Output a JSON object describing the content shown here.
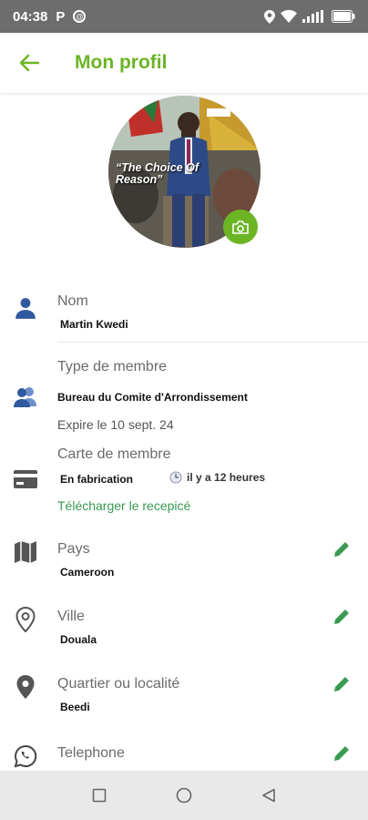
{
  "status_bar": {
    "time": "04:38",
    "p_icon": "P",
    "notif_icon": "@"
  },
  "header": {
    "title": "Mon profil",
    "back_icon": "arrow-left-icon",
    "accent_color": "#6bb524"
  },
  "avatar": {
    "banner_text": "“The Choice Of Reason”",
    "camera_icon": "camera-icon"
  },
  "fields": {
    "name": {
      "label": "Nom",
      "value": "Martin Kwedi",
      "icon": "person-icon"
    },
    "member_type": {
      "label": "Type de membre",
      "value": "Bureau du Comite d'Arrondissement",
      "expiry": "Expire le 10 sept. 24",
      "icon": "group-icon"
    },
    "member_card": {
      "label": "Carte de membre",
      "status": "En fabrication",
      "time_ago": "il y a 12 heures",
      "download_link": "Télécharger le recepicé",
      "icon": "card-icon"
    },
    "country": {
      "label": "Pays",
      "value": "Cameroon",
      "icon": "map-icon"
    },
    "city": {
      "label": "Ville",
      "value": "Douala",
      "icon": "location-outline-icon"
    },
    "district": {
      "label": "Quartier ou localité",
      "value": "Beedi",
      "icon": "location-pin-icon"
    },
    "phone": {
      "label": "Telephone",
      "icon": "whatsapp-icon"
    }
  },
  "nav_bar": {
    "recent_icon": "square-icon",
    "home_icon": "circle-icon",
    "back_icon": "triangle-back-icon"
  }
}
